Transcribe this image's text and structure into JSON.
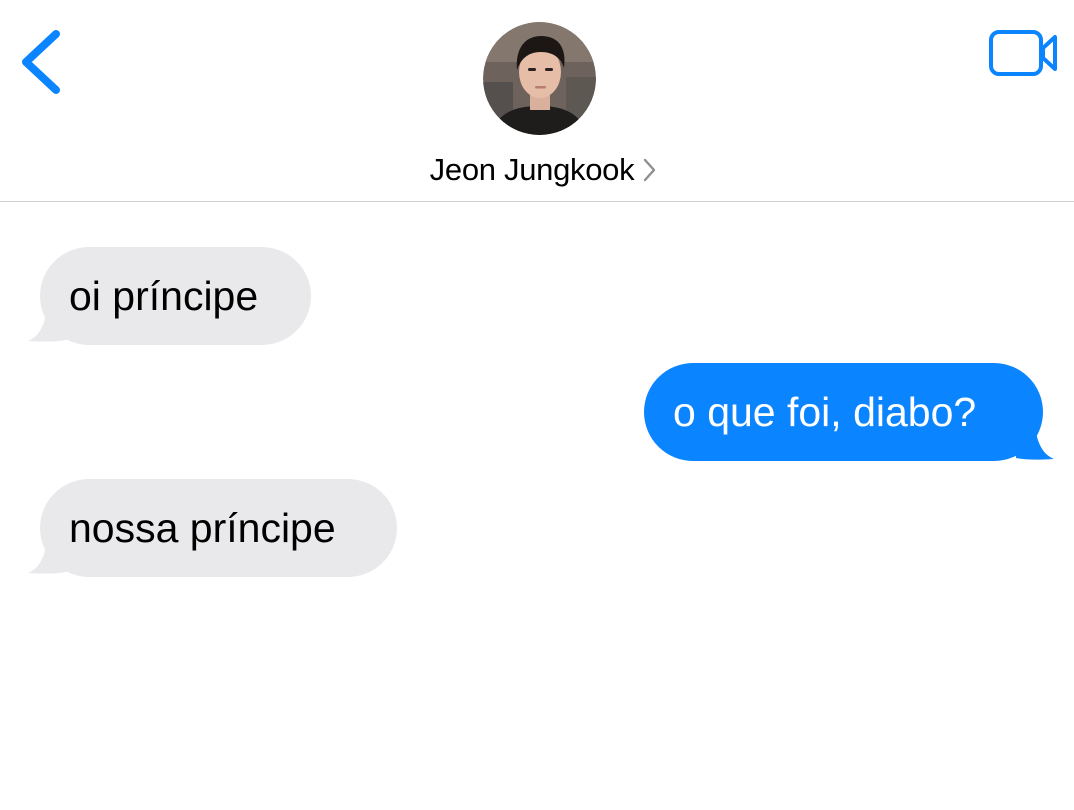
{
  "header": {
    "back_icon": "chevron-left-icon",
    "video_icon": "video-camera-icon",
    "avatar_icon": "contact-photo",
    "contact_name": "Jeon Jungkook",
    "disclosure_icon": "chevron-right-icon"
  },
  "colors": {
    "accent": "#0b84ff",
    "received_bubble": "#e9e9eb",
    "sent_bubble": "#0b84ff",
    "divider": "#cfcfd4"
  },
  "messages": [
    {
      "direction": "received",
      "text": "oi príncipe"
    },
    {
      "direction": "sent",
      "text": "o que foi, diabo?"
    },
    {
      "direction": "received",
      "text": "nossa príncipe"
    }
  ]
}
